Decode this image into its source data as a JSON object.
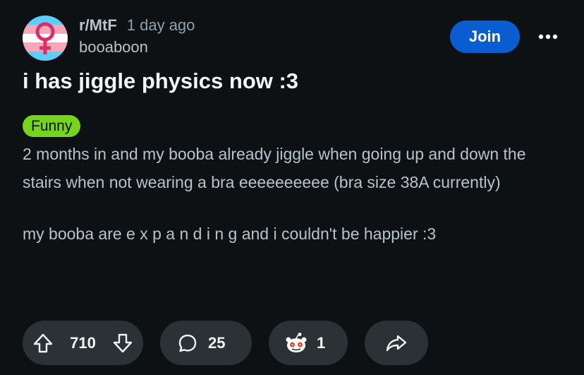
{
  "header": {
    "subreddit": "r/MtF",
    "separator": "·",
    "time_ago": "1 day ago",
    "author": "booaboon",
    "join_label": "Join",
    "more_icon": "more-horizontal-icon",
    "avatar_colors": [
      "#5bcefa",
      "#f5a9b8",
      "#ffffff"
    ],
    "avatar_symbol_color": "#d6306b"
  },
  "post": {
    "title": "i has jiggle physics now :3",
    "flair": "Funny",
    "flair_color": "#75d41c",
    "body": [
      "2 months in and my booba already jiggle when going up and down the stairs when not wearing a bra eeeeeeeeee (bra size 38A currently)",
      "my booba are e x p a n d i n g and i couldn't be happier :3"
    ]
  },
  "actions": {
    "upvote_icon": "upvote-arrow-icon",
    "vote_count": "710",
    "downvote_icon": "downvote-arrow-icon",
    "comment_icon": "comment-bubble-icon",
    "comment_count": "25",
    "award_icon": "award-snoo-icon",
    "award_count": "1",
    "share_icon": "share-arrow-icon"
  },
  "colors": {
    "background": "#0e1113",
    "join_button": "#0a5cd1",
    "pill_background": "#2a3236",
    "text_primary": "#f2f4f5",
    "text_secondary": "#b7c3cb"
  }
}
